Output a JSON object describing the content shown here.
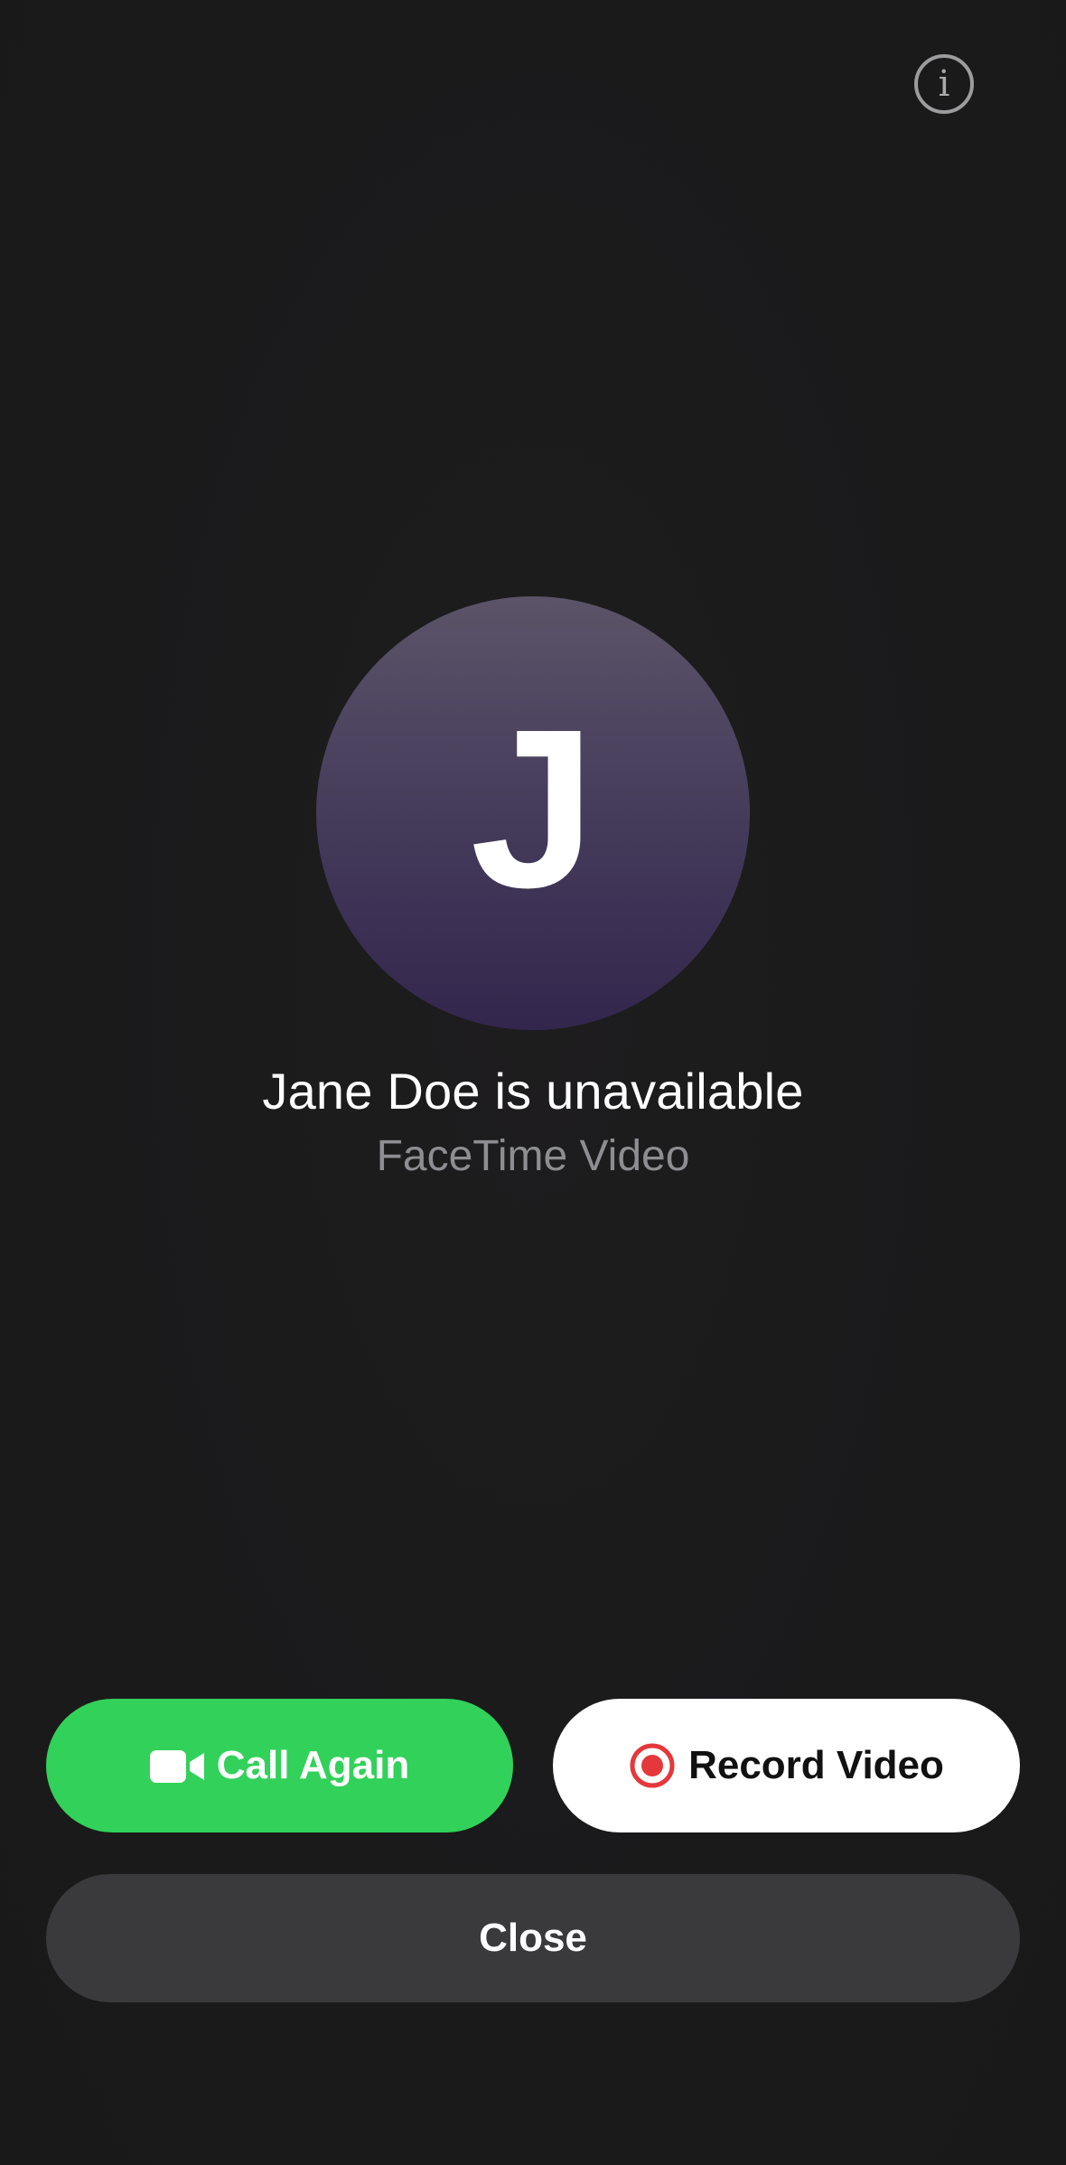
{
  "header": {
    "info_icon": "info-icon",
    "info_glyph": "i"
  },
  "contact": {
    "initial": "J",
    "avatar_gradient": [
      "#5b5468",
      "#33264d"
    ]
  },
  "status": {
    "title": "Jane Doe is unavailable",
    "subtitle": "FaceTime Video"
  },
  "actions": {
    "call_again": {
      "label": "Call Again",
      "icon": "video-camera-icon",
      "color": "#32d15a"
    },
    "record_video": {
      "label": "Record Video",
      "icon": "record-icon",
      "icon_color": "#e5383b"
    },
    "close": {
      "label": "Close"
    }
  },
  "colors": {
    "background": "#1b1b1c",
    "secondary_text": "#8e8e92"
  }
}
